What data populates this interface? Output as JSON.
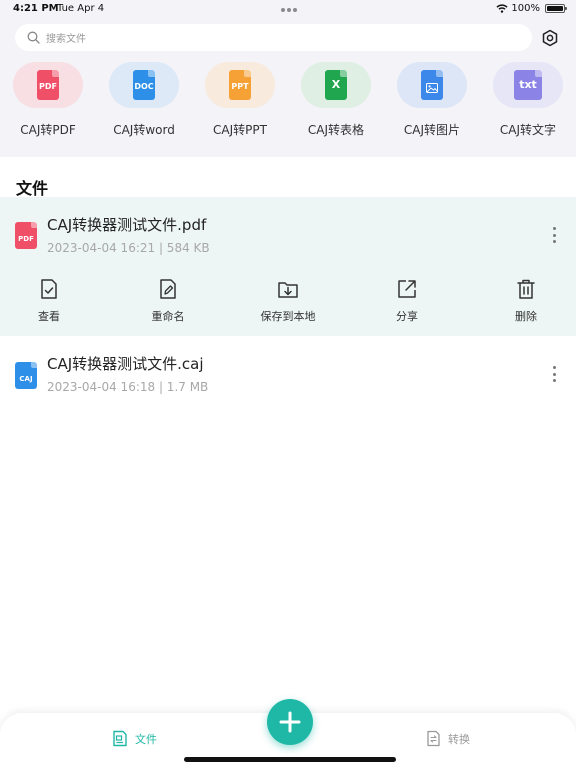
{
  "status_bar": {
    "time": "4:21 PM",
    "date": "Tue Apr 4",
    "battery": "100%"
  },
  "search": {
    "placeholder": "搜索文件"
  },
  "tools": [
    {
      "label": "CAJ转PDF",
      "icon": "pdf-file-icon",
      "badge": "PDF",
      "bg": "#f8dfe4",
      "color": "#f04f68"
    },
    {
      "label": "CAJ转word",
      "icon": "doc-file-icon",
      "badge": "DOC",
      "bg": "#dde9f6",
      "color": "#2d8fe8"
    },
    {
      "label": "CAJ转PPT",
      "icon": "ppt-file-icon",
      "badge": "PPT",
      "bg": "#f8ebdd",
      "color": "#f5a136"
    },
    {
      "label": "CAJ转表格",
      "icon": "excel-file-icon",
      "badge": "X",
      "bg": "#e0efe4",
      "color": "#21a650"
    },
    {
      "label": "CAJ转图片",
      "icon": "image-file-icon",
      "badge": "",
      "bg": "#dce6f6",
      "color": "#3b87ea"
    },
    {
      "label": "CAJ转文字",
      "icon": "txt-file-icon",
      "badge": "txt",
      "bg": "#e7e6f7",
      "color": "#8b84e6"
    }
  ],
  "section_title": "文件",
  "files": [
    {
      "name": "CAJ转换器测试文件.pdf",
      "meta": "2023-04-04 16:21 | 584 KB",
      "badge": "PDF",
      "color": "#f04f68"
    },
    {
      "name": "CAJ转换器测试文件.caj",
      "meta": "2023-04-04 16:18 | 1.7 MB",
      "badge": "CAJ",
      "color": "#2d8fe8"
    }
  ],
  "actions": [
    {
      "label": "查看",
      "icon": "view-icon"
    },
    {
      "label": "重命名",
      "icon": "rename-icon"
    },
    {
      "label": "保存到本地",
      "icon": "save-local-icon"
    },
    {
      "label": "分享",
      "icon": "share-icon"
    },
    {
      "label": "删除",
      "icon": "delete-icon"
    }
  ],
  "tabs": {
    "files": {
      "label": "文件",
      "active": true
    },
    "convert": {
      "label": "转换",
      "active": false
    }
  },
  "colors": {
    "accent": "#1fb8a6",
    "selected_row": "#edf6f4",
    "top_bg": "#f3f3f8"
  }
}
